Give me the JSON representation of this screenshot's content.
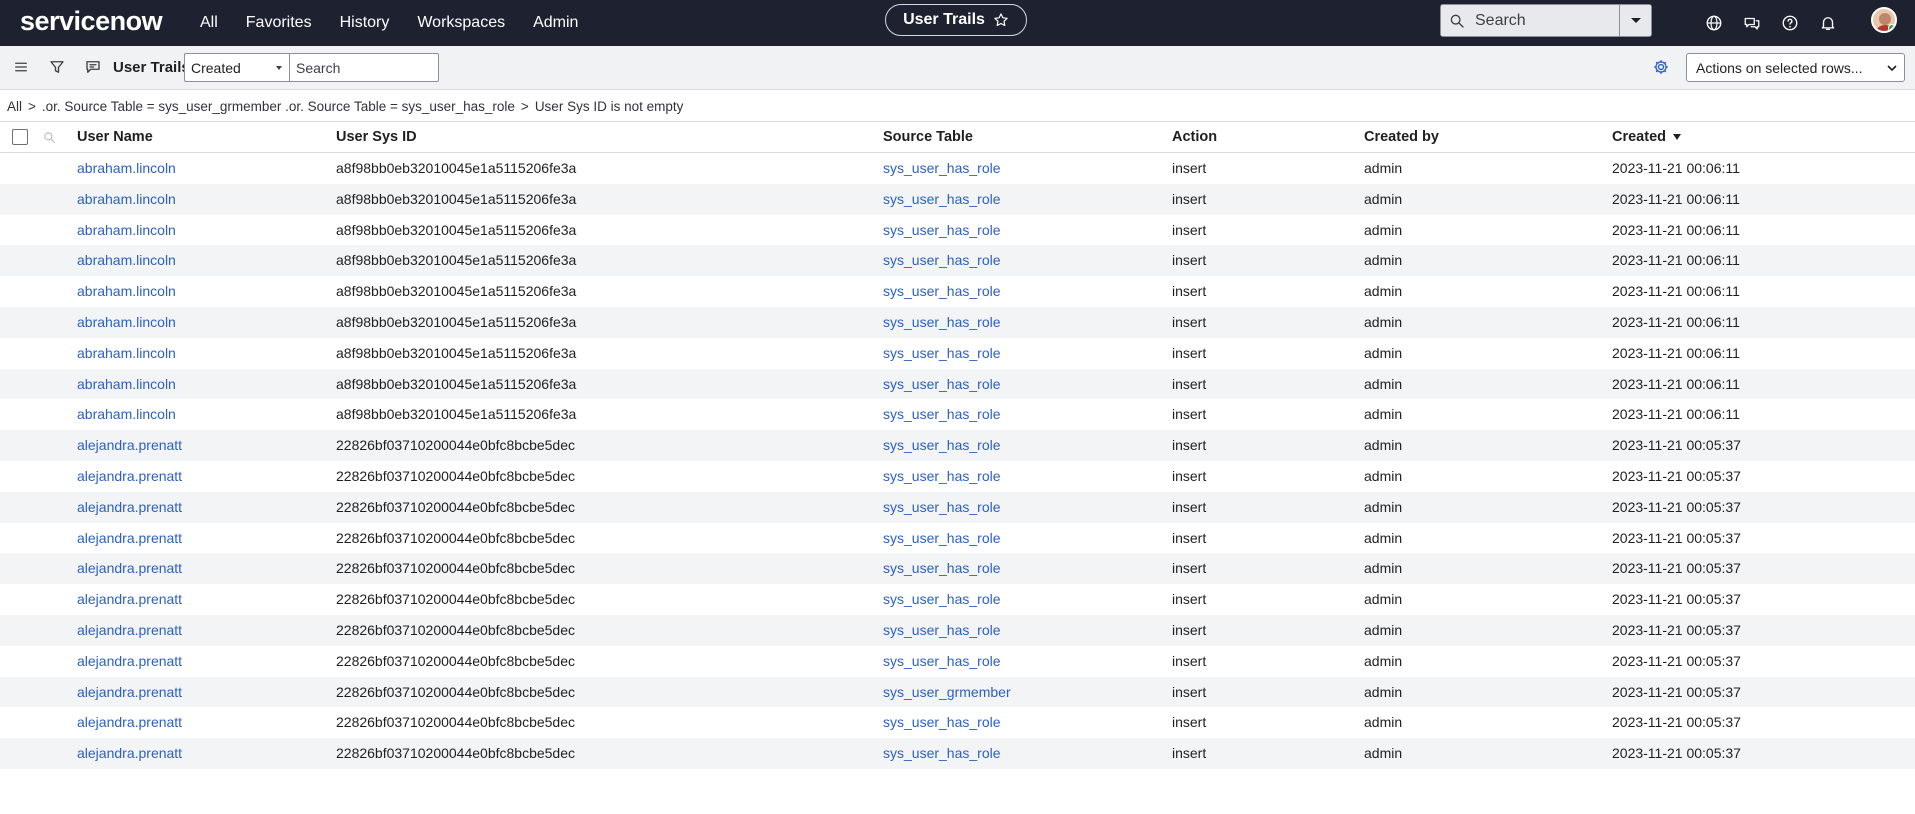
{
  "nav": {
    "brand": "servicenow",
    "links": [
      "All",
      "Favorites",
      "History",
      "Workspaces",
      "Admin"
    ],
    "context_title": "User Trails",
    "search_placeholder": "Search"
  },
  "list": {
    "title": "User Trails",
    "field_select": "Created",
    "search_placeholder": "Search",
    "actions_label": "Actions on selected rows..."
  },
  "breadcrumb": [
    "All",
    ".or. Source Table = sys_user_grmember .or. Source Table = sys_user_has_role",
    "User Sys ID is not empty"
  ],
  "columns": [
    "User Name",
    "User Sys ID",
    "Source Table",
    "Action",
    "Created by",
    "Created"
  ],
  "rows": [
    [
      "abraham.lincoln",
      "a8f98bb0eb32010045e1a5115206fe3a",
      "sys_user_has_role",
      "insert",
      "admin",
      "2023-11-21 00:06:11"
    ],
    [
      "abraham.lincoln",
      "a8f98bb0eb32010045e1a5115206fe3a",
      "sys_user_has_role",
      "insert",
      "admin",
      "2023-11-21 00:06:11"
    ],
    [
      "abraham.lincoln",
      "a8f98bb0eb32010045e1a5115206fe3a",
      "sys_user_has_role",
      "insert",
      "admin",
      "2023-11-21 00:06:11"
    ],
    [
      "abraham.lincoln",
      "a8f98bb0eb32010045e1a5115206fe3a",
      "sys_user_has_role",
      "insert",
      "admin",
      "2023-11-21 00:06:11"
    ],
    [
      "abraham.lincoln",
      "a8f98bb0eb32010045e1a5115206fe3a",
      "sys_user_has_role",
      "insert",
      "admin",
      "2023-11-21 00:06:11"
    ],
    [
      "abraham.lincoln",
      "a8f98bb0eb32010045e1a5115206fe3a",
      "sys_user_has_role",
      "insert",
      "admin",
      "2023-11-21 00:06:11"
    ],
    [
      "abraham.lincoln",
      "a8f98bb0eb32010045e1a5115206fe3a",
      "sys_user_has_role",
      "insert",
      "admin",
      "2023-11-21 00:06:11"
    ],
    [
      "abraham.lincoln",
      "a8f98bb0eb32010045e1a5115206fe3a",
      "sys_user_has_role",
      "insert",
      "admin",
      "2023-11-21 00:06:11"
    ],
    [
      "abraham.lincoln",
      "a8f98bb0eb32010045e1a5115206fe3a",
      "sys_user_has_role",
      "insert",
      "admin",
      "2023-11-21 00:06:11"
    ],
    [
      "alejandra.prenatt",
      "22826bf03710200044e0bfc8bcbe5dec",
      "sys_user_has_role",
      "insert",
      "admin",
      "2023-11-21 00:05:37"
    ],
    [
      "alejandra.prenatt",
      "22826bf03710200044e0bfc8bcbe5dec",
      "sys_user_has_role",
      "insert",
      "admin",
      "2023-11-21 00:05:37"
    ],
    [
      "alejandra.prenatt",
      "22826bf03710200044e0bfc8bcbe5dec",
      "sys_user_has_role",
      "insert",
      "admin",
      "2023-11-21 00:05:37"
    ],
    [
      "alejandra.prenatt",
      "22826bf03710200044e0bfc8bcbe5dec",
      "sys_user_has_role",
      "insert",
      "admin",
      "2023-11-21 00:05:37"
    ],
    [
      "alejandra.prenatt",
      "22826bf03710200044e0bfc8bcbe5dec",
      "sys_user_has_role",
      "insert",
      "admin",
      "2023-11-21 00:05:37"
    ],
    [
      "alejandra.prenatt",
      "22826bf03710200044e0bfc8bcbe5dec",
      "sys_user_has_role",
      "insert",
      "admin",
      "2023-11-21 00:05:37"
    ],
    [
      "alejandra.prenatt",
      "22826bf03710200044e0bfc8bcbe5dec",
      "sys_user_has_role",
      "insert",
      "admin",
      "2023-11-21 00:05:37"
    ],
    [
      "alejandra.prenatt",
      "22826bf03710200044e0bfc8bcbe5dec",
      "sys_user_has_role",
      "insert",
      "admin",
      "2023-11-21 00:05:37"
    ],
    [
      "alejandra.prenatt",
      "22826bf03710200044e0bfc8bcbe5dec",
      "sys_user_grmember",
      "insert",
      "admin",
      "2023-11-21 00:05:37"
    ],
    [
      "alejandra.prenatt",
      "22826bf03710200044e0bfc8bcbe5dec",
      "sys_user_has_role",
      "insert",
      "admin",
      "2023-11-21 00:05:37"
    ],
    [
      "alejandra.prenatt",
      "22826bf03710200044e0bfc8bcbe5dec",
      "sys_user_has_role",
      "insert",
      "admin",
      "2023-11-21 00:05:37"
    ]
  ],
  "colors": {
    "nav_bg": "#1d2130",
    "link": "#2b5fc6",
    "row_alt": "#f3f4f6"
  },
  "icons": {
    "toolbar": [
      "hamburger-icon",
      "filter-icon",
      "comment-icon"
    ],
    "top": [
      "globe-icon",
      "chat-icon",
      "help-icon",
      "bell-icon"
    ]
  }
}
